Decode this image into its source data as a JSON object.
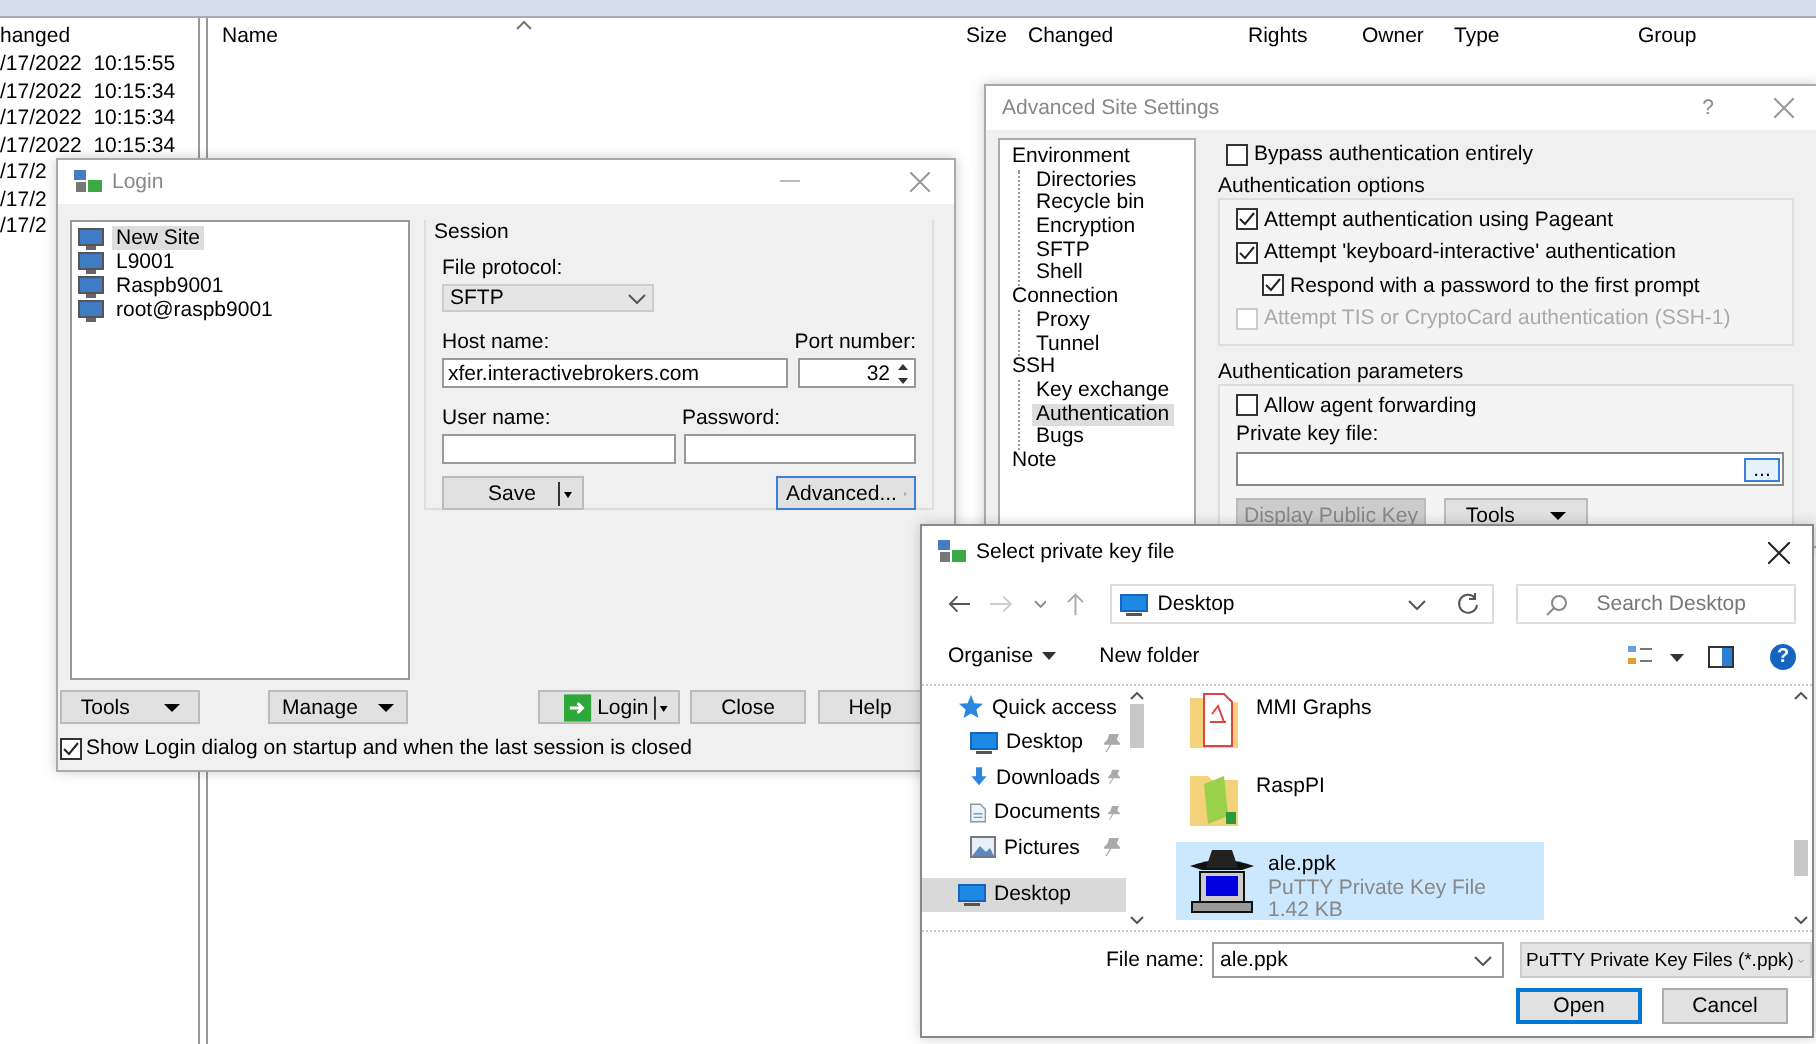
{
  "explorer": {
    "left_column": "hanged",
    "left_rows": [
      "/17/2022  10:15:55",
      "/17/2022  10:15:34",
      "/17/2022  10:15:34",
      "/17/2022  10:15:34",
      "/17/2",
      "/17/2",
      "/17/2"
    ],
    "columns": [
      "Name",
      "Size",
      "Changed",
      "Rights",
      "Owner",
      "Type",
      "Group"
    ]
  },
  "login": {
    "title": "Login",
    "sites": [
      {
        "label": "New Site",
        "selected": true
      },
      {
        "label": "L9001",
        "selected": false
      },
      {
        "label": "Raspb9001",
        "selected": false
      },
      {
        "label": "root@raspb9001",
        "selected": false
      }
    ],
    "session": {
      "title": "Session",
      "protocol_label": "File protocol:",
      "protocol": "SFTP",
      "host_label": "Host name:",
      "host": "xfer.interactivebrokers.com",
      "port_label": "Port number:",
      "port": "32",
      "user_label": "User name:",
      "password_label": "Password:",
      "save": "Save",
      "advanced": "Advanced..."
    },
    "left_buttons": [
      "Tools",
      "Manage"
    ],
    "login_button": "Login",
    "right_buttons": [
      "Close",
      "Help"
    ],
    "startup": {
      "label": "Show Login dialog on startup and when the last session is closed",
      "checked": true
    }
  },
  "advanced": {
    "title": "Advanced Site Settings",
    "help": "?",
    "tree": [
      {
        "label": "Environment",
        "selected": false,
        "children": [
          {
            "label": "Directories",
            "selected": false
          },
          {
            "label": "Recycle bin",
            "selected": false
          },
          {
            "label": "Encryption",
            "selected": false
          },
          {
            "label": "SFTP",
            "selected": false
          },
          {
            "label": "Shell",
            "selected": false
          }
        ]
      },
      {
        "label": "Connection",
        "selected": false,
        "children": [
          {
            "label": "Proxy",
            "selected": false
          },
          {
            "label": "Tunnel",
            "selected": false
          }
        ]
      },
      {
        "label": "SSH",
        "selected": false,
        "children": [
          {
            "label": "Key exchange",
            "selected": false
          },
          {
            "label": "Authentication",
            "selected": true
          },
          {
            "label": "Bugs",
            "selected": false
          }
        ]
      },
      {
        "label": "Note",
        "selected": false
      }
    ],
    "bypass": {
      "label": "Bypass authentication entirely",
      "checked": false
    },
    "options_title": "Authentication options",
    "options": [
      {
        "label": "Attempt authentication using Pageant",
        "checked": true,
        "disabled": false
      },
      {
        "label": "Attempt 'keyboard-interactive' authentication",
        "checked": true,
        "disabled": false,
        "children": [
          {
            "label": "Respond with a password to the first prompt",
            "checked": true,
            "disabled": false
          }
        ]
      },
      {
        "label": "Attempt TIS or CryptoCard authentication (SSH-1)",
        "checked": false,
        "disabled": true
      }
    ],
    "params_title": "Authentication parameters",
    "agent": {
      "label": "Allow agent forwarding",
      "checked": false
    },
    "key_label": "Private key file:",
    "browse": "...",
    "display_key": "Display Public Key",
    "tools": "Tools"
  },
  "file_dialog": {
    "title": "Select private key file",
    "location": "Desktop",
    "search_placeholder": "Search Desktop",
    "organise": "Organise",
    "new_folder": "New folder",
    "help": "?",
    "nav": [
      {
        "label": "Quick access",
        "kind": "star",
        "pinned": false,
        "selected": false
      },
      {
        "label": "Desktop",
        "kind": "desktop",
        "pinned": true,
        "selected": false
      },
      {
        "label": "Downloads",
        "kind": "download",
        "pinned": true,
        "selected": false
      },
      {
        "label": "Documents",
        "kind": "documents",
        "pinned": true,
        "selected": false
      },
      {
        "label": "Pictures",
        "kind": "pictures",
        "pinned": true,
        "selected": false
      },
      {
        "label": "Desktop",
        "kind": "desktop",
        "pinned": false,
        "selected": true
      }
    ],
    "files": [
      {
        "name": "MMI Graphs",
        "kind": "pdf-folder",
        "selected": false
      },
      {
        "name": "RaspPI",
        "kind": "folder",
        "selected": false
      },
      {
        "name": "ale.ppk",
        "kind": "key",
        "type": "PuTTY Private Key File",
        "size": "1.42 KB",
        "selected": true
      }
    ],
    "filename_label": "File name:",
    "filename": "ale.ppk",
    "filter": "PuTTY Private Key Files (*.ppk)",
    "open": "Open",
    "cancel": "Cancel"
  }
}
